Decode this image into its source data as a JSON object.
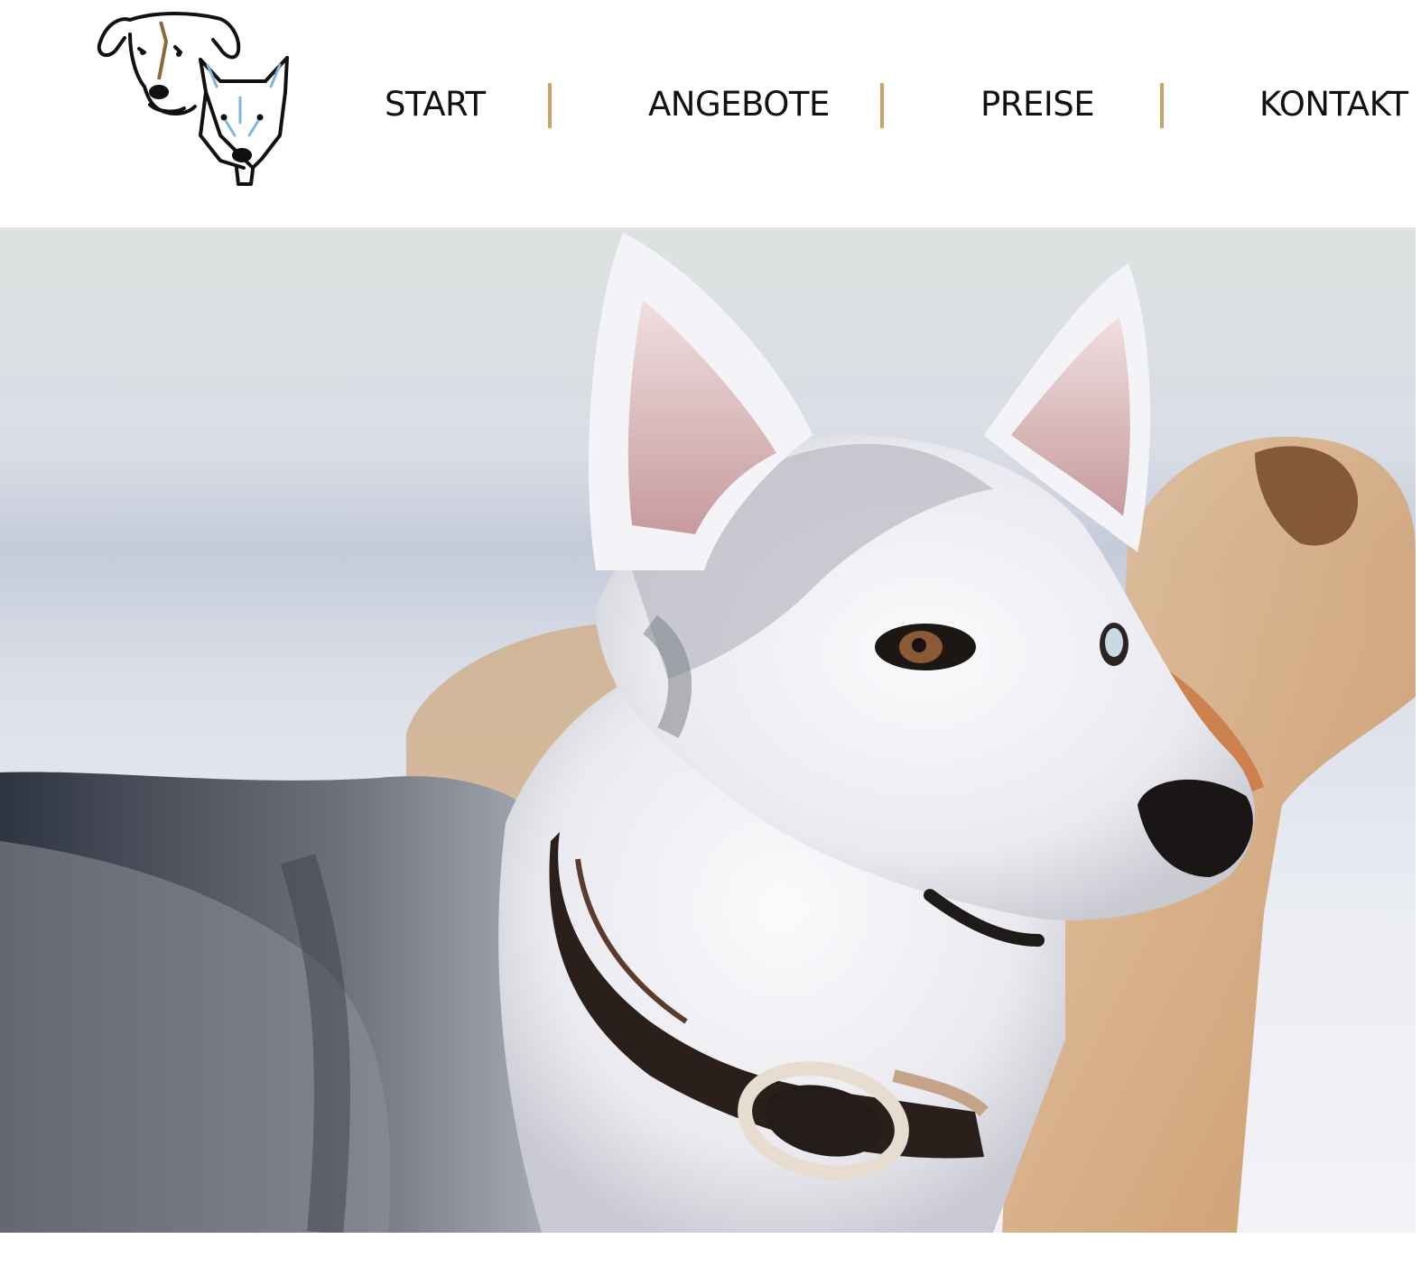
{
  "nav": {
    "items": [
      {
        "label": "START"
      },
      {
        "label": "ANGEBOTE"
      },
      {
        "label": "PREISE"
      },
      {
        "label": "KONTAKT"
      }
    ],
    "separator_color": "#c8a46c"
  },
  "logo": {
    "icon": "two-dog-heads-logo",
    "colors": [
      "#111111",
      "#8a6a3c",
      "#7fb7dc"
    ]
  },
  "hero": {
    "icon": "husky-in-snow-photo"
  }
}
